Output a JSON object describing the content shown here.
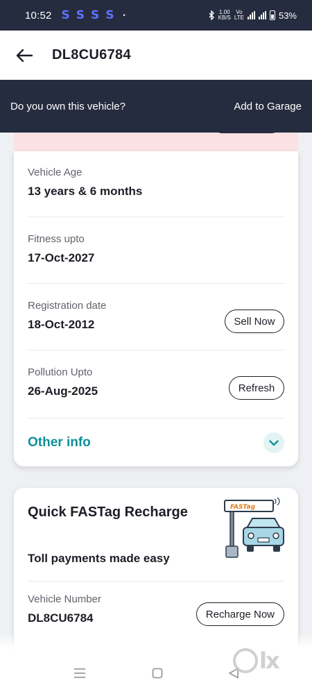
{
  "status_bar": {
    "time": "10:52",
    "app_icons": [
      "S",
      "S",
      "S",
      "S"
    ],
    "dot": "•",
    "speed_top": "1.00",
    "speed_bottom": "KB/S",
    "net_top": "Vo",
    "net_bottom": "LTE",
    "battery": "53%"
  },
  "header": {
    "title": "DL8CU6784"
  },
  "banner": {
    "question": "Do you own this vehicle?",
    "action": "Add to Garage"
  },
  "details": {
    "rows": [
      {
        "label": "Vehicle Age",
        "value": "13 years & 6 months",
        "button": ""
      },
      {
        "label": "Fitness upto",
        "value": "17-Oct-2027",
        "button": ""
      },
      {
        "label": "Registration date",
        "value": "18-Oct-2012",
        "button": "Sell Now"
      },
      {
        "label": "Pollution Upto",
        "value": "26-Aug-2025",
        "button": "Refresh"
      }
    ],
    "other_info": "Other info"
  },
  "fastag": {
    "title": "Quick FASTag Recharge",
    "subtitle": "Toll payments made easy",
    "sign_text": "FASTag",
    "vehicle_label": "Vehicle Number",
    "vehicle_value": "DL8CU6784",
    "button": "Recharge Now"
  },
  "watermark": "lx",
  "colors": {
    "dark_navy": "#262c3f",
    "teal": "#10909a",
    "pink": "#fbe1e3"
  }
}
